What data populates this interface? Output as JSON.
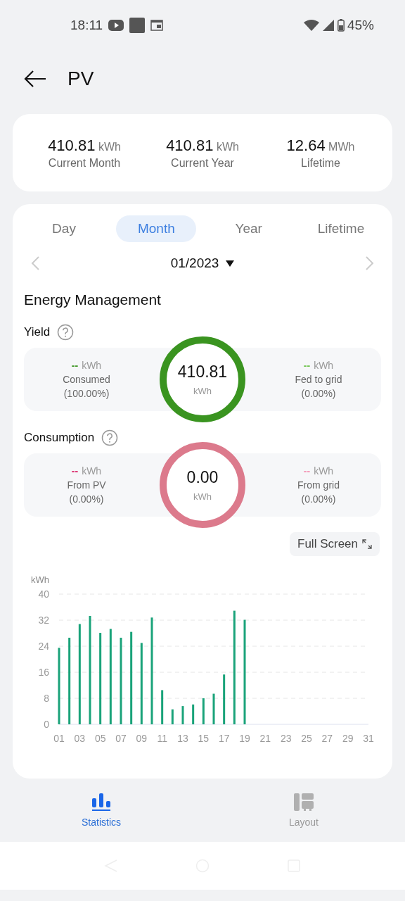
{
  "status_bar": {
    "time": "18:11",
    "battery": "45%"
  },
  "header": {
    "title": "PV"
  },
  "summary": [
    {
      "value": "410.81",
      "unit": "kWh",
      "label": "Current Month"
    },
    {
      "value": "410.81",
      "unit": "kWh",
      "label": "Current Year"
    },
    {
      "value": "12.64",
      "unit": "MWh",
      "label": "Lifetime"
    }
  ],
  "tabs": [
    {
      "label": "Day",
      "selected": false
    },
    {
      "label": "Month",
      "selected": true
    },
    {
      "label": "Year",
      "selected": false
    },
    {
      "label": "Lifetime",
      "selected": false
    }
  ],
  "date_picker": {
    "value": "01/2023"
  },
  "section_title": "Energy Management",
  "flows": [
    {
      "title": "Yield",
      "color": "#3a9420",
      "total": "410.81",
      "unit": "kWh",
      "left": {
        "value": "--",
        "unit": "kWh",
        "label": "Consumed",
        "percent": "(100.00%)",
        "color": "#3a9420"
      },
      "right": {
        "value": "--",
        "unit": "kWh",
        "label": "Fed to grid",
        "percent": "(0.00%)",
        "color": "#6cc24a"
      }
    },
    {
      "title": "Consumption",
      "color": "#dc7a8c",
      "total": "0.00",
      "unit": "kWh",
      "left": {
        "value": "--",
        "unit": "kWh",
        "label": "From PV",
        "percent": "(0.00%)",
        "color": "#d81b60"
      },
      "right": {
        "value": "--",
        "unit": "kWh",
        "label": "From grid",
        "percent": "(0.00%)",
        "color": "#f48fb1"
      }
    }
  ],
  "full_screen_button": "Full Screen",
  "chart_data": {
    "type": "bar",
    "ylabel": "kWh",
    "x": [
      1,
      2,
      3,
      4,
      5,
      6,
      7,
      8,
      9,
      10,
      11,
      12,
      13,
      14,
      15,
      16,
      17,
      18,
      19
    ],
    "series": [
      {
        "color": "#1aa37a",
        "values": [
          23.5,
          26.6,
          30.8,
          33.3,
          28.1,
          29.3,
          26.6,
          28.4,
          25.0,
          32.8,
          10.5,
          4.6,
          5.6,
          6.1,
          8.0,
          9.4,
          15.3,
          34.9,
          32.1
        ]
      }
    ],
    "xlim": [
      1,
      31
    ],
    "ylim": [
      0,
      40
    ],
    "grid": true,
    "yticks": [
      0,
      8,
      16,
      24,
      32,
      40
    ],
    "xticks": [
      {
        "value": 1,
        "label": "01"
      },
      {
        "value": 3,
        "label": "03"
      },
      {
        "value": 5,
        "label": "05"
      },
      {
        "value": 7,
        "label": "07"
      },
      {
        "value": 9,
        "label": "09"
      },
      {
        "value": 11,
        "label": "11"
      },
      {
        "value": 13,
        "label": "13"
      },
      {
        "value": 15,
        "label": "15"
      },
      {
        "value": 17,
        "label": "17"
      },
      {
        "value": 19,
        "label": "19"
      },
      {
        "value": 21,
        "label": "21"
      },
      {
        "value": 23,
        "label": "23"
      },
      {
        "value": 25,
        "label": "25"
      },
      {
        "value": 27,
        "label": "27"
      },
      {
        "value": 29,
        "label": "29"
      },
      {
        "value": 31,
        "label": "31"
      }
    ]
  },
  "bottom_nav": [
    {
      "label": "Statistics",
      "selected": true,
      "kind": "statistics"
    },
    {
      "label": "Layout",
      "selected": false,
      "kind": "layout"
    }
  ]
}
